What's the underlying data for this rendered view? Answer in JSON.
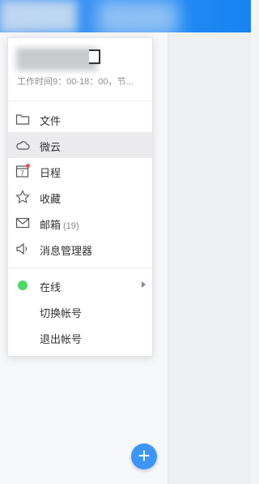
{
  "profile": {
    "status": "工作时间9：00-18：00，节..."
  },
  "menu": {
    "files": "文件",
    "cloud": "微云",
    "calendar": "日程",
    "calendar_date": "7",
    "favorites": "收藏",
    "mail": "邮箱",
    "mail_count": "(19)",
    "message_manager": "消息管理器",
    "online": "在线",
    "switch_account": "切换帐号",
    "logout": "退出帐号"
  },
  "fab": {
    "symbol": "+"
  },
  "colors": {
    "accent": "#1684f2",
    "online": "#4cd964",
    "notify": "#e8504f"
  }
}
